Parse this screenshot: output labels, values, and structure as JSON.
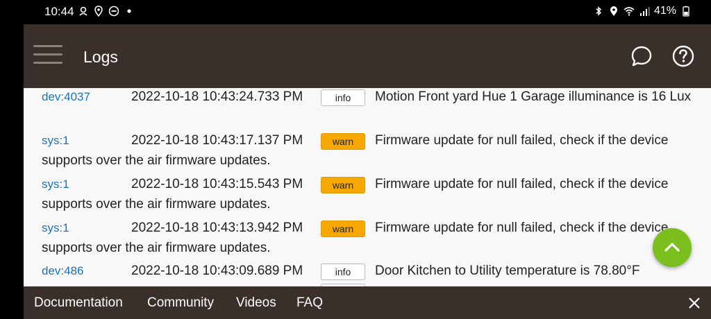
{
  "status_bar": {
    "time": "10:44",
    "battery": "41%",
    "left_icons": [
      "notification-icon",
      "location-icon",
      "dnd-icon",
      "dot-icon"
    ],
    "right_icons": [
      "bluetooth-icon",
      "location-icon",
      "wifi-icon",
      "signal-icon",
      "battery-icon"
    ]
  },
  "header": {
    "title": "Logs"
  },
  "logs": [
    {
      "source": "dev:4037",
      "time": "2022-10-18 10:43:24.733 PM",
      "level": "info",
      "message": "Motion Front yard Hue 1 Garage illuminance is 16 Lux"
    },
    {
      "source": "sys:1",
      "time": "2022-10-18 10:43:17.137 PM",
      "level": "warn",
      "message": "Firmware update for null failed, check if the device supports over the air firmware updates."
    },
    {
      "source": "sys:1",
      "time": "2022-10-18 10:43:15.543 PM",
      "level": "warn",
      "message": "Firmware update for null failed, check if the device supports over the air firmware updates."
    },
    {
      "source": "sys:1",
      "time": "2022-10-18 10:43:13.942 PM",
      "level": "warn",
      "message": "Firmware update for null failed, check if the device supports over the air firmware updates."
    },
    {
      "source": "dev:486",
      "time": "2022-10-18 10:43:09.689 PM",
      "level": "info",
      "message": "Door Kitchen to Utility temperature is 78.80°F"
    }
  ],
  "footer": {
    "links": [
      "Documentation",
      "Community",
      "Videos",
      "FAQ"
    ]
  },
  "colors": {
    "header_bg": "#3b2f2c",
    "warn": "#f7a800",
    "fab": "#7bbf1e",
    "link": "#1a73b8"
  }
}
